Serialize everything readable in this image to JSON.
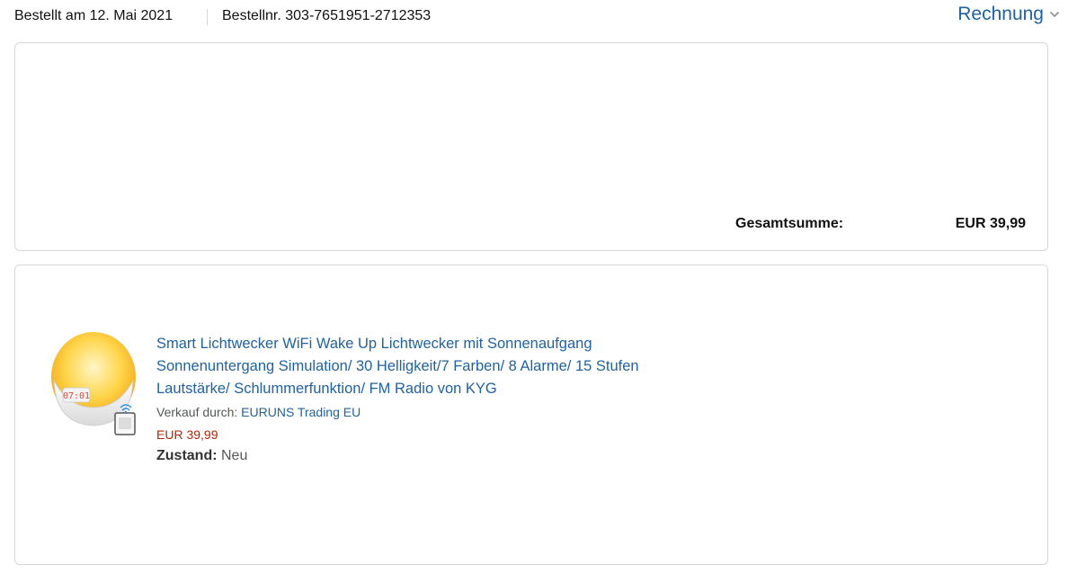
{
  "order": {
    "date_text": "Bestellt am 12. Mai 2021",
    "number_text": "Bestellnr. 303-7651951-2712353",
    "invoice_label": "Rechnung"
  },
  "summary": {
    "total_label": "Gesamtsumme:",
    "total_value": "EUR 39,99"
  },
  "item": {
    "title_line1": "Smart Lichtwecker WiFi Wake Up Lichtwecker mit Sonnenaufgang",
    "title_line2": "Sonnenuntergang Simulation/ 30 Helligkeit/7 Farben/ 8 Alarme/ 15 Stufen",
    "title_line3": "Lautstärke/ Schlummerfunktion/ FM Radio von KYG",
    "seller_prefix": "Verkauf durch:",
    "seller_name": "EURUNS Trading EU",
    "price": "EUR 39,99",
    "condition_label": "Zustand:",
    "condition_value": "Neu",
    "clock_display": "07:01"
  },
  "colors": {
    "link": "#2162a1",
    "price": "#b12704",
    "border": "#d5d9d9"
  },
  "icons": {
    "invoice_dropdown": "chevron-down-icon"
  }
}
